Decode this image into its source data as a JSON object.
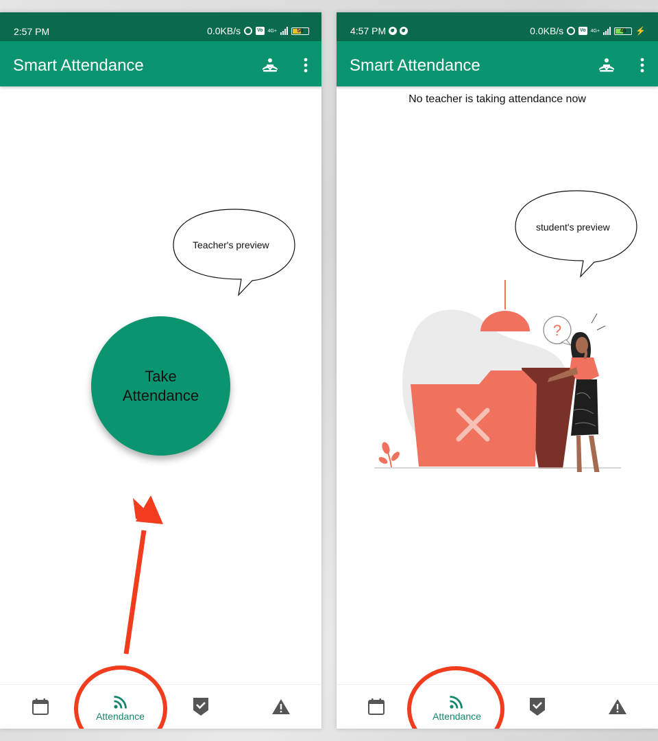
{
  "colors": {
    "status_bar": "#0a6b4c",
    "app_bar": "#0b9470",
    "accent": "#12876a",
    "highlight_red": "#f23c1e",
    "illustration_coral": "#f0725e"
  },
  "left_phone": {
    "status": {
      "time": "2:57 PM",
      "speed": "0.0KB/s",
      "network": "4G+",
      "battery": "50"
    },
    "app_title": "Smart Attendance",
    "speech_bubble": "Teacher's preview",
    "take_button": {
      "line1": "Take",
      "line2": "Attendance"
    },
    "nav": {
      "attendance_label": "Attendance"
    }
  },
  "right_phone": {
    "status": {
      "time": "4:57 PM",
      "speed": "0.0KB/s",
      "network": "4G+",
      "battery": "46"
    },
    "app_title": "Smart Attendance",
    "message": "No teacher is taking attendance now",
    "speech_bubble": "student's preview",
    "illustration_mark": "?",
    "nav": {
      "attendance_label": "Attendance"
    }
  }
}
